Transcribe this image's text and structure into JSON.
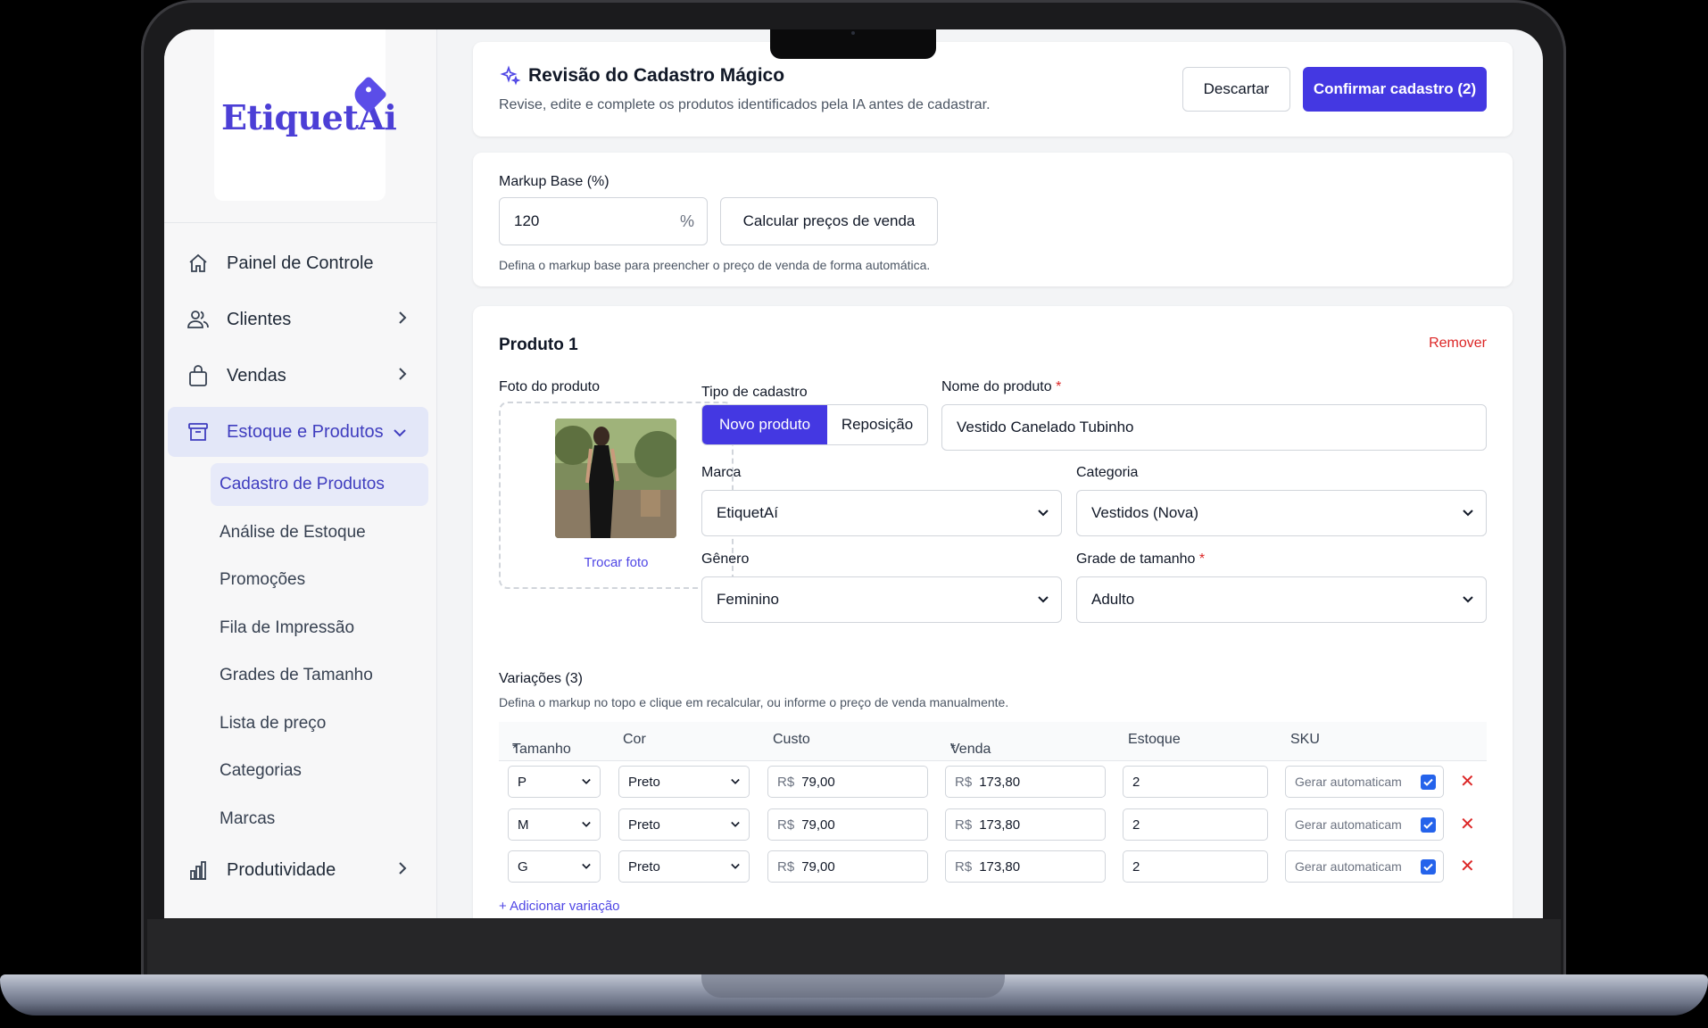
{
  "brand": {
    "name": "EtiquetAi",
    "accent": "#4438e2"
  },
  "sidebar": {
    "items": [
      {
        "label": "Painel de Controle",
        "icon": "home-icon"
      },
      {
        "label": "Clientes",
        "icon": "users-icon"
      },
      {
        "label": "Vendas",
        "icon": "bag-icon"
      },
      {
        "label": "Estoque e Produtos",
        "icon": "archive-icon"
      }
    ],
    "sub_items": [
      "Cadastro de Produtos",
      "Análise de Estoque",
      "Promoções",
      "Fila de Impressão",
      "Grades de Tamanho",
      "Lista de preço",
      "Categorias",
      "Marcas"
    ],
    "bottom_item": {
      "label": "Produtividade",
      "icon": "bar-chart-icon"
    }
  },
  "header": {
    "title": "Revisão do Cadastro Mágico",
    "subtitle": "Revise, edite e complete os produtos identificados pela IA antes de cadastrar.",
    "discard_label": "Descartar",
    "confirm_label": "Confirmar cadastro (2)"
  },
  "markup": {
    "label": "Markup Base (%)",
    "value": "120",
    "suffix": "%",
    "calc_label": "Calcular preços de venda",
    "hint": "Defina o markup base para preencher o preço de venda de forma automática."
  },
  "product": {
    "title": "Produto 1",
    "remove_label": "Remover",
    "photo_label": "Foto do produto",
    "change_photo": "Trocar foto",
    "type_label": "Tipo de cadastro",
    "type_options": [
      "Novo produto",
      "Reposição"
    ],
    "name_label": "Nome do produto",
    "name_value": "Vestido Canelado Tubinho",
    "brand_label": "Marca",
    "brand_value": "EtiquetAí",
    "category_label": "Categoria",
    "category_value": "Vestidos (Nova)",
    "gender_label": "Gênero",
    "gender_value": "Feminino",
    "size_grid_label": "Grade de tamanho",
    "size_grid_value": "Adulto",
    "required_mark": "*"
  },
  "variations": {
    "title": "Variações (3)",
    "hint": "Defina o markup no topo e clique em recalcular, ou informe o preço de venda manualmente.",
    "columns": [
      "Tamanho",
      "Cor",
      "Custo",
      "Venda",
      "Estoque",
      "SKU"
    ],
    "currency": "R$",
    "rows": [
      {
        "size": "P",
        "color": "Preto",
        "cost": "79,00",
        "sale": "173,80",
        "stock": "2",
        "sku": "Gerar automaticam"
      },
      {
        "size": "M",
        "color": "Preto",
        "cost": "79,00",
        "sale": "173,80",
        "stock": "2",
        "sku": "Gerar automaticam"
      },
      {
        "size": "G",
        "color": "Preto",
        "cost": "79,00",
        "sale": "173,80",
        "stock": "2",
        "sku": "Gerar automaticam"
      }
    ],
    "add_label": "+ Adicionar variação"
  }
}
